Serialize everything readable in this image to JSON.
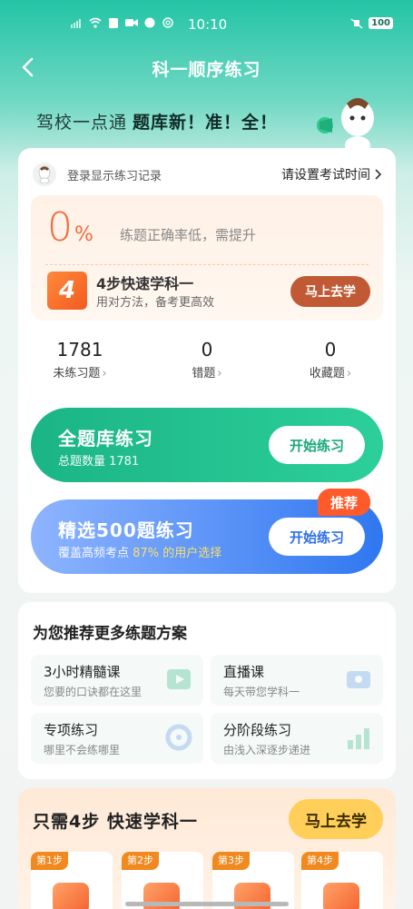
{
  "status": {
    "time": "10:10",
    "battery": "100"
  },
  "nav": {
    "title": "科一顺序练习"
  },
  "slogan": {
    "prefix": "驾校一点通",
    "bold": "题库新！准！全！"
  },
  "login": {
    "text": "登录显示练习记录",
    "exam_time": "请设置考试时间"
  },
  "accuracy": {
    "value": "0",
    "unit": "%",
    "text": "练题正确率低，需提升"
  },
  "quick_step": {
    "title": "4步快速学科一",
    "subtitle": "用对方法，备考更高效",
    "button": "马上去学",
    "icon_text": "4"
  },
  "stats": [
    {
      "value": "1781",
      "label": "未练习题"
    },
    {
      "value": "0",
      "label": "错题"
    },
    {
      "value": "0",
      "label": "收藏题"
    }
  ],
  "practice_all": {
    "title": "全题库练习",
    "subtitle": "总题数量 1781",
    "button": "开始练习"
  },
  "practice_selected": {
    "title": "精选500题练习",
    "subtitle_prefix": "覆盖高频考点",
    "subtitle_highlight": "87%",
    "subtitle_suffix": "的用户选择",
    "button": "开始练习",
    "badge": "推荐"
  },
  "recommend": {
    "title": "为您推荐更多练题方案",
    "tiles": [
      {
        "title": "3小时精髓课",
        "subtitle": "您要的口诀都在这里"
      },
      {
        "title": "直播课",
        "subtitle": "每天带您学科一"
      },
      {
        "title": "专项练习",
        "subtitle": "哪里不会练哪里"
      },
      {
        "title": "分阶段练习",
        "subtitle": "由浅入深逐步递进"
      }
    ]
  },
  "steps": {
    "title": "只需4步  快速学科一",
    "button": "马上去学",
    "items": [
      {
        "tag": "第1步"
      },
      {
        "tag": "第2步"
      },
      {
        "tag": "第3步"
      },
      {
        "tag": "第4步"
      }
    ]
  },
  "colors": {
    "accent_green": "#1bb585",
    "accent_blue": "#2f77f0",
    "accent_orange": "#f46a3c"
  }
}
